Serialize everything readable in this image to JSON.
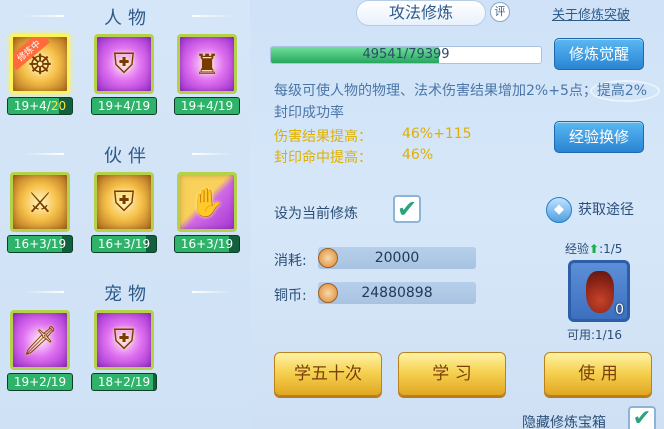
{
  "left": {
    "sections": {
      "character": "人物",
      "partner": "伙伴",
      "pet": "宠物"
    },
    "character_slots": [
      {
        "level": "19+4/",
        "level_hi": "20",
        "tag": "修炼中",
        "progress": 0.8
      },
      {
        "level": "19+4/19",
        "progress": 1.0
      },
      {
        "level": "19+4/19",
        "progress": 1.0
      }
    ],
    "partner_slots": [
      {
        "level": "16+3/19",
        "progress": 0.84
      },
      {
        "level": "16+3/19",
        "progress": 0.84
      },
      {
        "level": "16+3/19",
        "progress": 0.84
      }
    ],
    "pet_slots": [
      {
        "level": "19+2/19",
        "progress": 1.0
      },
      {
        "level": "18+2/19",
        "progress": 0.95
      }
    ]
  },
  "header": {
    "title": "攻法修炼",
    "rate": "评",
    "about": "关于修炼突破"
  },
  "progress": {
    "text": "49541/79399",
    "fraction": 0.624
  },
  "buttons": {
    "awaken": "修炼觉醒",
    "exchange": "经验换修",
    "learn50": "学五十次",
    "learn": "学 习",
    "use": "使 用"
  },
  "description": "每级可使人物的物理、法术伤害结果增加2%+5点；提高2%封印成功率",
  "stats": [
    {
      "label": "伤害结果提高：",
      "value": "46%+115"
    },
    {
      "label": "封印命中提高：",
      "value": "46%"
    }
  ],
  "set_current": {
    "label": "设为当前修炼",
    "checked": true
  },
  "acquire": "获取途径",
  "cost": {
    "consume_label": "消耗:",
    "consume_value": "20000",
    "coin_label": "铜币:",
    "coin_value": "24880898"
  },
  "item": {
    "exp_label": "经验",
    "exp_value": ":1/5",
    "count": "0",
    "usable": "可用:1/16"
  },
  "hide": {
    "label": "隐藏修炼宝箱",
    "checked": true
  },
  "colors": {
    "accent_blue": "#2a84d4",
    "stat_yellow": "#e0b000",
    "level_green": "#2fb36b"
  }
}
